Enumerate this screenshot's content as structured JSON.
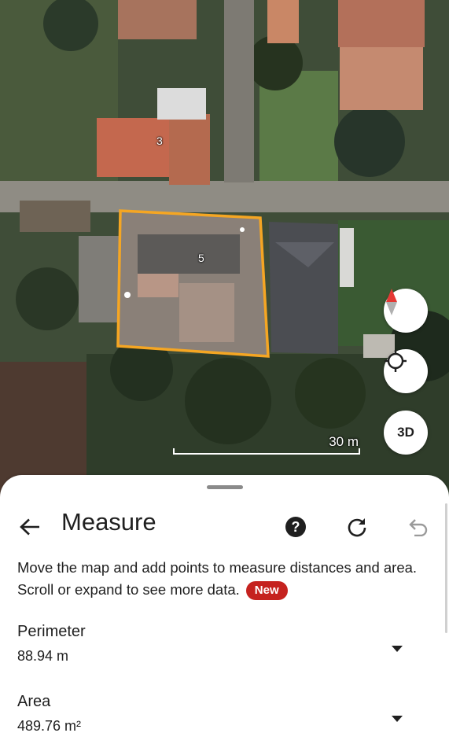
{
  "map": {
    "house_labels": [
      "3",
      "5"
    ],
    "scale_label": "30 m",
    "measure_outline_color": "#f5a623",
    "buttons": {
      "compass_icon": "compass-icon",
      "location_icon": "my-location-icon",
      "three_d_label": "3D"
    }
  },
  "sheet": {
    "title": "Measure",
    "back_icon": "arrow-back-icon",
    "help_icon": "help-icon",
    "refresh_icon": "refresh-icon",
    "undo_icon": "undo-icon",
    "description": "Move the map and add points to measure distances and area. Scroll or expand to see more data.",
    "badge": "New",
    "accent_color": "#c5221f",
    "metrics": [
      {
        "label": "Perimeter",
        "value": "88.94 m"
      },
      {
        "label": "Area",
        "value": "489.76 m²"
      }
    ]
  }
}
